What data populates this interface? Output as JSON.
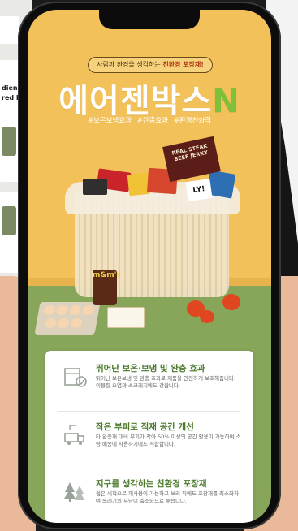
{
  "background": {
    "left_headline_lines": [
      "dien",
      "red E"
    ]
  },
  "promo": {
    "tagline_prefix": "사람과 환경을 생각하는",
    "tagline_highlight": "친환경 포장재!",
    "brand_main": "에어젠박스",
    "brand_letter": "N",
    "tags": [
      "#보온보냉효과",
      "#완충효과",
      "#환경친화적"
    ],
    "product_label_jerky": "REAL STEAK BEEF JERKY",
    "product_label_ly": "LY!",
    "product_label_mms": "m&m's"
  },
  "features": [
    {
      "icon": "box-insulation-icon",
      "title": "뛰어난 보온·보냉 및 완충 효과",
      "desc": "뛰어난 보온보냉 및 완충 효과로 제품을 안전하게 보호해줍니다. 이물질 오염과 스크래치에도 강합니다."
    },
    {
      "icon": "delivery-space-icon",
      "title": "작은 부피로 적재 공간 개선",
      "desc": "타 완충재 대비 부피가 작아 50% 이상의 공간 활용이 가능하여 소량 배송에 사용하기에도 적합합니다."
    },
    {
      "icon": "eco-trees-icon",
      "title": "지구를 생각하는 친환경 포장재",
      "desc": "쉽은 세척으로 재사용이 가능하고 쓰러 뒤에도 포장재를 최소화하여 쓰레기의 부담이 축소되므로 좋습니다."
    }
  ],
  "colors": {
    "wall": "#f2c15a",
    "table": "#87a65a",
    "accent_green": "#4a7a2a",
    "tagline_red": "#b03a14"
  }
}
